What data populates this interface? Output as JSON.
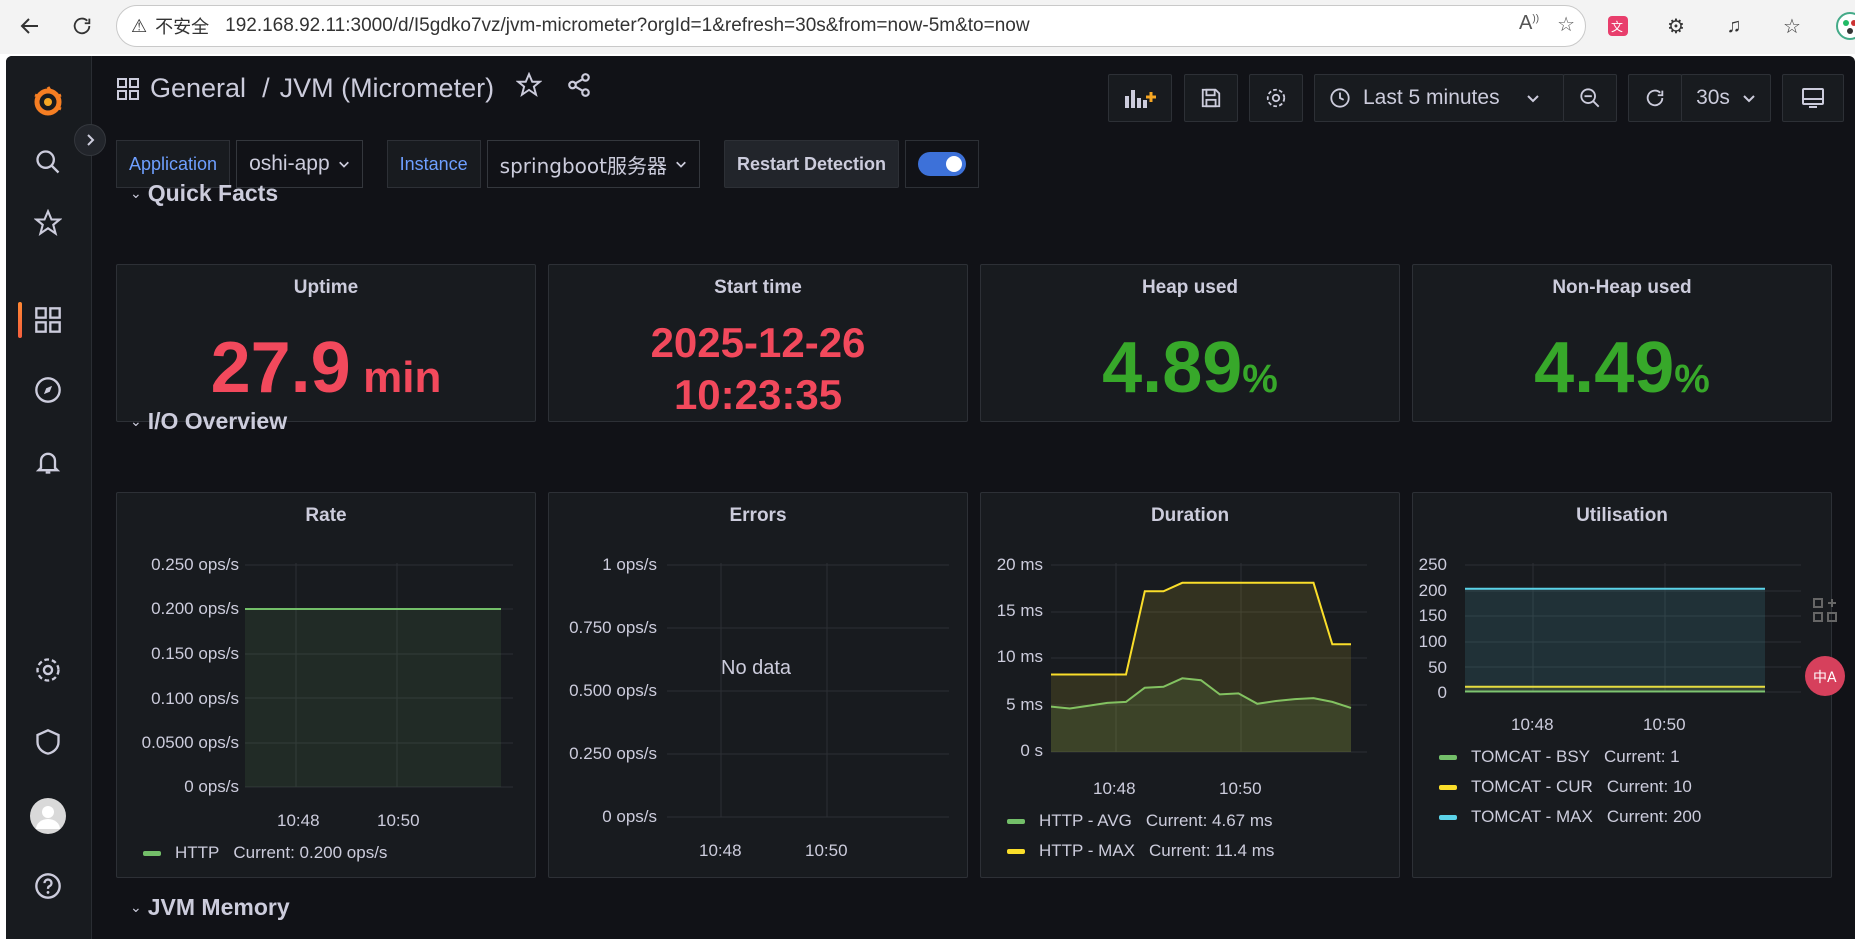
{
  "browser": {
    "insecure_label": "不安全",
    "url": "192.168.92.11:3000/d/I5gdko7vz/jvm-micrometer?orgId=1&refresh=30s&from=now-5m&to=now",
    "icons": [
      "back-icon",
      "reload-icon",
      "warning-icon",
      "read-aloud-icon",
      "favorite-star-icon",
      "translate-icon",
      "extensions-icon",
      "media-icon",
      "favorites-icon",
      "profile-icon"
    ]
  },
  "sidebar": {
    "items": [
      "grafana-logo",
      "search-icon",
      "starred-icon",
      "dashboards-icon",
      "explore-icon",
      "alerting-icon",
      "configuration-icon",
      "server-admin-icon",
      "profile-avatar",
      "help-icon"
    ],
    "accent": "#f55f3e"
  },
  "topbar": {
    "folder": "General",
    "separator": "/",
    "dashboard": "JVM (Micrometer)",
    "time_range": "Last 5 minutes",
    "refresh": "30s"
  },
  "variables": {
    "application_label": "Application",
    "application_value": "oshi-app",
    "instance_label": "Instance",
    "instance_value": "springboot服务器",
    "restart_label": "Restart Detection",
    "restart_enabled": true
  },
  "rows": {
    "quick_facts": "Quick Facts",
    "io_overview": "I/O Overview",
    "jvm_memory": "JVM Memory"
  },
  "stats": {
    "uptime": {
      "title": "Uptime",
      "value": "27.9",
      "unit": "min",
      "color": "#f2495c"
    },
    "start_time": {
      "title": "Start time",
      "date": "2025-12-26",
      "time": "10:23:35",
      "color": "#f2495c"
    },
    "heap": {
      "title": "Heap used",
      "value": "4.89",
      "unit": "%",
      "color": "#37a82a"
    },
    "non_heap": {
      "title": "Non-Heap used",
      "value": "4.49",
      "unit": "%",
      "color": "#37a82a"
    }
  },
  "panels": {
    "rate": {
      "title": "Rate",
      "yticks": [
        "0.250 ops/s",
        "0.200 ops/s",
        "0.150 ops/s",
        "0.100 ops/s",
        "0.0500 ops/s",
        "0 ops/s"
      ],
      "xticks": [
        "10:48",
        "10:50"
      ],
      "legend": [
        {
          "name": "HTTP",
          "current": "Current: 0.200 ops/s",
          "color": "#73bf69"
        }
      ]
    },
    "errors": {
      "title": "Errors",
      "yticks": [
        "1 ops/s",
        "0.750 ops/s",
        "0.500 ops/s",
        "0.250 ops/s",
        "0 ops/s"
      ],
      "xticks": [
        "10:48",
        "10:50"
      ],
      "nodata": "No data"
    },
    "duration": {
      "title": "Duration",
      "yticks": [
        "20 ms",
        "15 ms",
        "10 ms",
        "5 ms",
        "0 s"
      ],
      "xticks": [
        "10:48",
        "10:50"
      ],
      "legend": [
        {
          "name": "HTTP - AVG",
          "current": "Current: 4.67 ms",
          "color": "#73bf69"
        },
        {
          "name": "HTTP - MAX",
          "current": "Current: 11.4 ms",
          "color": "#fade2a"
        }
      ]
    },
    "utilisation": {
      "title": "Utilisation",
      "yticks": [
        "250",
        "200",
        "150",
        "100",
        "50",
        "0"
      ],
      "xticks": [
        "10:48",
        "10:50"
      ],
      "legend": [
        {
          "name": "TOMCAT - BSY",
          "current": "Current: 1",
          "color": "#73bf69"
        },
        {
          "name": "TOMCAT - CUR",
          "current": "Current: 10",
          "color": "#fade2a"
        },
        {
          "name": "TOMCAT - MAX",
          "current": "Current: 200",
          "color": "#5bd3e8"
        }
      ]
    }
  },
  "chart_data": [
    {
      "type": "line",
      "title": "Rate",
      "x": [
        "10:47:30",
        "10:48",
        "10:49",
        "10:50",
        "10:51:30"
      ],
      "series": [
        {
          "name": "HTTP",
          "values": [
            0.2,
            0.2,
            0.2,
            0.2,
            0.2
          ]
        }
      ],
      "ylim": [
        0,
        0.25
      ]
    },
    {
      "type": "line",
      "title": "Errors",
      "series": [],
      "ylim": [
        0,
        1
      ]
    },
    {
      "type": "line",
      "title": "Duration",
      "x": [
        "10:47:30",
        "10:47:45",
        "10:48",
        "10:48:15",
        "10:48:30",
        "10:48:45",
        "10:49",
        "10:49:15",
        "10:49:30",
        "10:49:45",
        "10:50",
        "10:50:15",
        "10:50:30",
        "10:50:45",
        "10:51",
        "10:51:15",
        "10:51:30"
      ],
      "series": [
        {
          "name": "HTTP - AVG",
          "values": [
            4.8,
            4.6,
            4.9,
            5.2,
            5.3,
            6.8,
            6.9,
            7.8,
            7.6,
            6.1,
            6.2,
            5.1,
            5.4,
            5.6,
            5.7,
            5.3,
            4.67
          ]
        },
        {
          "name": "HTTP - MAX",
          "values": [
            8.2,
            8.2,
            8.2,
            8.2,
            8.2,
            17,
            17,
            17.9,
            17.9,
            17.9,
            17.9,
            17.9,
            17.9,
            17.9,
            17.9,
            11.4,
            11.4
          ]
        }
      ],
      "ylim": [
        0,
        20
      ]
    },
    {
      "type": "line",
      "title": "Utilisation",
      "x": [
        "10:47:30",
        "10:48",
        "10:49",
        "10:50",
        "10:51:30"
      ],
      "series": [
        {
          "name": "TOMCAT - BSY",
          "values": [
            1,
            1,
            1,
            1,
            1
          ]
        },
        {
          "name": "TOMCAT - CUR",
          "values": [
            10,
            10,
            10,
            10,
            10
          ]
        },
        {
          "name": "TOMCAT - MAX",
          "values": [
            200,
            200,
            200,
            200,
            200
          ]
        }
      ],
      "ylim": [
        0,
        250
      ]
    }
  ]
}
